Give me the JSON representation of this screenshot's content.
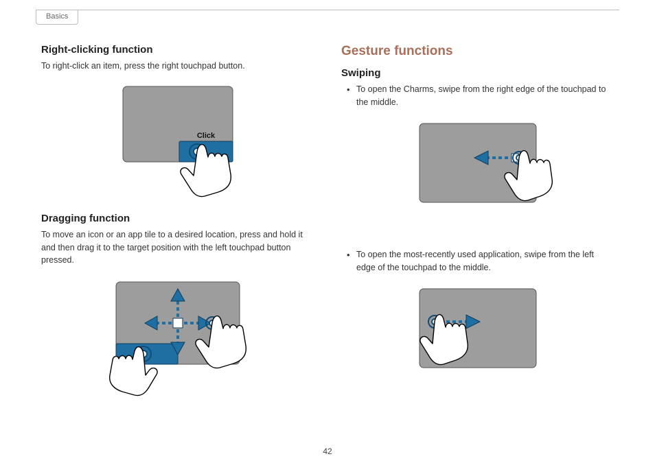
{
  "header": {
    "breadcrumb": "Basics"
  },
  "page_number": "42",
  "left": {
    "right_click": {
      "heading": "Right-clicking function",
      "body": "To right-click an item, press the right touchpad button.",
      "click_label": "Click"
    },
    "dragging": {
      "heading": "Dragging function",
      "body": "To move an icon or an app tile to a desired location, press and hold it and then drag it to the target position with the left touchpad button pressed."
    }
  },
  "right": {
    "section": "Gesture functions",
    "swiping": {
      "heading": "Swiping",
      "bullets": [
        "To open the Charms, swipe from the right edge of the touchpad to the middle.",
        "To open the most-recently used application, swipe from the left edge of the touchpad to the middle."
      ]
    }
  }
}
